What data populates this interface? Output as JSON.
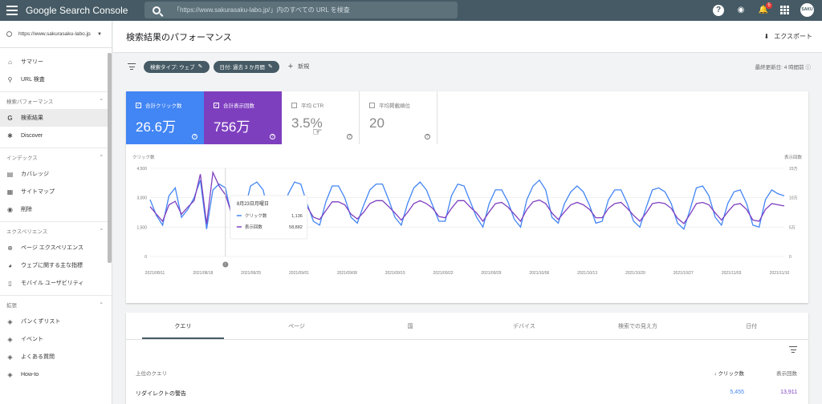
{
  "app": {
    "title": "Google Search Console",
    "search_placeholder": "「https://www.sakurasaku-labo.jp/」内のすべての URL を検査",
    "avatar_text": "SAKU LABO",
    "notification_count": "5"
  },
  "sidebar": {
    "property": "https://www.sakurasaku-labo.jp/",
    "top_items": [
      {
        "label": "サマリー",
        "icon": "home-icon"
      },
      {
        "label": "URL 検査",
        "icon": "search-icon"
      }
    ],
    "sections": [
      {
        "title": "検索パフォーマンス",
        "items": [
          {
            "label": "検索結果",
            "icon": "google-g-icon",
            "active": true
          },
          {
            "label": "Discover",
            "icon": "asterisk-icon"
          }
        ]
      },
      {
        "title": "インデックス",
        "items": [
          {
            "label": "カバレッジ",
            "icon": "file-icon"
          },
          {
            "label": "サイトマップ",
            "icon": "sitemap-icon"
          },
          {
            "label": "削除",
            "icon": "eye-off-icon"
          }
        ]
      },
      {
        "title": "エクスペリエンス",
        "items": [
          {
            "label": "ページ エクスペリエンス",
            "icon": "circle-plus-icon"
          },
          {
            "label": "ウェブに関する主な指標",
            "icon": "gauge-icon"
          },
          {
            "label": "モバイル ユーザビリティ",
            "icon": "phone-icon"
          }
        ]
      },
      {
        "title": "拡張",
        "items": [
          {
            "label": "パンくずリスト",
            "icon": "layers-icon"
          },
          {
            "label": "イベント",
            "icon": "layers-icon"
          },
          {
            "label": "よくある質問",
            "icon": "layers-icon"
          },
          {
            "label": "How-to",
            "icon": "layers-icon"
          }
        ]
      }
    ]
  },
  "header": {
    "title": "検索結果のパフォーマンス",
    "export_label": "エクスポート"
  },
  "filters": {
    "chips": [
      "検索タイプ: ウェブ",
      "日付: 過去 3 か月間"
    ],
    "new_label": "新規",
    "updated": "最終更新日: 4 時間前"
  },
  "metrics": [
    {
      "label": "合計クリック数",
      "value": "26.6万",
      "checked": true
    },
    {
      "label": "合計表示回数",
      "value": "756万",
      "checked": true
    },
    {
      "label": "平均 CTR",
      "value": "3.5%",
      "checked": false
    },
    {
      "label": "平均掲載順位",
      "value": "20",
      "checked": false
    }
  ],
  "colors": {
    "clicks": "#4285f4",
    "impressions": "#7e3fbf",
    "topbar": "#455a64"
  },
  "chart_data": {
    "type": "line",
    "ylabel_left": "クリック数",
    "ylabel_right": "表示回数",
    "yticks_left": [
      "4,500",
      "3,000",
      "1,500",
      "0"
    ],
    "yticks_right": [
      "15万",
      "10万",
      "5万",
      "0"
    ],
    "ylim_left": [
      0,
      4500
    ],
    "ylim_right": [
      0,
      150000
    ],
    "x_labels": [
      "2021/08/11",
      "2021/08/18",
      "2021/08/25",
      "2021/09/01",
      "2021/09/08",
      "2021/09/15",
      "2021/09/22",
      "2021/09/29",
      "2021/10/06",
      "2021/10/13",
      "2021/10/20",
      "2021/10/27",
      "2021/11/03",
      "2021/11/10"
    ],
    "series": [
      {
        "name": "クリック数",
        "axis": "left",
        "values": [
          2900,
          2100,
          1600,
          3100,
          3500,
          2000,
          2400,
          3000,
          3900,
          1400,
          3400,
          3700,
          3500,
          2000,
          1500,
          2300,
          3600,
          3800,
          3400,
          2000,
          1500,
          2200,
          3200,
          3800,
          3700,
          2700,
          1800,
          1600,
          2800,
          3600,
          3600,
          3000,
          2000,
          1700,
          2600,
          3400,
          3700,
          3700,
          2900,
          2000,
          1600,
          2700,
          3500,
          3800,
          3400,
          2600,
          1800,
          1800,
          3100,
          3700,
          3600,
          2800,
          2000,
          1500,
          2700,
          3400,
          3400,
          2800,
          1900,
          1500,
          2900,
          3600,
          3900,
          3400,
          2000,
          1700,
          2700,
          3300,
          3600,
          3300,
          2600,
          1700,
          1800,
          2900,
          3400,
          3400,
          2700,
          1800,
          1500,
          2500,
          3400,
          3500,
          3300,
          2700,
          1700,
          1400,
          2400,
          3500,
          3600,
          3100,
          2000,
          1600,
          2700,
          3300,
          3400,
          2700,
          1600,
          1500,
          2900,
          3400,
          3200,
          3100
        ]
      },
      {
        "name": "表示回数",
        "axis": "right",
        "values": [
          85000,
          72000,
          60000,
          88000,
          94000,
          72000,
          84000,
          95000,
          140000,
          55000,
          143000,
          120000,
          105000,
          72000,
          58000,
          70000,
          95000,
          98000,
          95000,
          75000,
          60000,
          68000,
          88000,
          98000,
          97000,
          85000,
          67000,
          63000,
          78000,
          93000,
          93000,
          88000,
          72000,
          64000,
          75000,
          90000,
          95000,
          95000,
          85000,
          74000,
          62000,
          75000,
          90000,
          95000,
          90000,
          82000,
          68000,
          66000,
          82000,
          95000,
          95000,
          84000,
          74000,
          60000,
          76000,
          90000,
          92000,
          84000,
          72000,
          60000,
          80000,
          93000,
          96000,
          90000,
          74000,
          63000,
          76000,
          88000,
          92000,
          88000,
          80000,
          66000,
          66000,
          82000,
          90000,
          92000,
          82000,
          70000,
          60000,
          74000,
          90000,
          92000,
          90000,
          82000,
          65000,
          56000,
          72000,
          90000,
          92000,
          88000,
          74000,
          62000,
          76000,
          88000,
          90000,
          80000,
          62000,
          60000,
          80000,
          90000,
          88000,
          86000
        ]
      }
    ],
    "tooltip": {
      "date": "8月23日月曜日",
      "rows": [
        {
          "label": "クリック数",
          "value": "1,136"
        },
        {
          "label": "表示回数",
          "value": "58,882"
        }
      ]
    }
  },
  "table": {
    "tabs": [
      "クエリ",
      "ページ",
      "国",
      "デバイス",
      "検索での見え方",
      "日付"
    ],
    "headers": {
      "query": "上位のクエリ",
      "clicks": "クリック数",
      "impressions": "表示回数"
    },
    "rows": [
      {
        "query": "リダイレクトの警告",
        "clicks": "5,455",
        "impressions": "13,911"
      }
    ]
  }
}
